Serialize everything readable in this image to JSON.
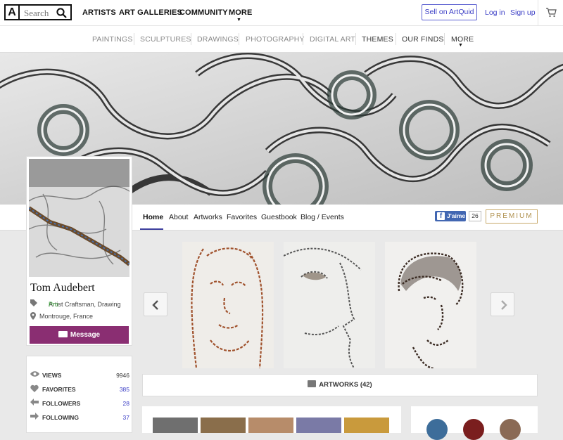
{
  "header": {
    "logo": "A",
    "search_placeholder": "Search",
    "nav": [
      "ARTISTS",
      "ART GALLERIES",
      "COMMUNITY",
      "MORE"
    ],
    "sell_label": "Sell on ArtQuid",
    "login": "Log in",
    "signup": "Sign up",
    "cart_icon": "cart-icon"
  },
  "categories": [
    "PAINTINGS",
    "SCULPTURES",
    "DRAWINGS",
    "PHOTOGRAPHY",
    "DIGITAL ART",
    "THEMES",
    "OUR FINDS",
    "MORE"
  ],
  "profile_tabs": [
    "Home",
    "About",
    "Artworks",
    "Favorites",
    "Guestbook",
    "Blog / Events"
  ],
  "social": {
    "fb_label": "J'aime",
    "fb_count": "26",
    "premium": "PREMIUM"
  },
  "artist": {
    "name": "Tom Audebert",
    "role": "Artist Craftsman, Drawing",
    "badge": "Pro",
    "location": "Montrouge, France",
    "message_label": "Message"
  },
  "stats": [
    {
      "label": "VIEWS",
      "value": "9946",
      "icon": "eye-icon"
    },
    {
      "label": "FAVORITES",
      "value": "385",
      "icon": "heart-icon"
    },
    {
      "label": "FOLLOWERS",
      "value": "28",
      "icon": "arrow-left-icon"
    },
    {
      "label": "FOLLOWING",
      "value": "37",
      "icon": "arrow-right-icon"
    }
  ],
  "artworks_label": "ARTWORKS (42)",
  "colors": {
    "accent": "#3c3fc6",
    "message": "#8a2e72",
    "pro": "#3aa63a",
    "premium": "#c8a96a"
  }
}
